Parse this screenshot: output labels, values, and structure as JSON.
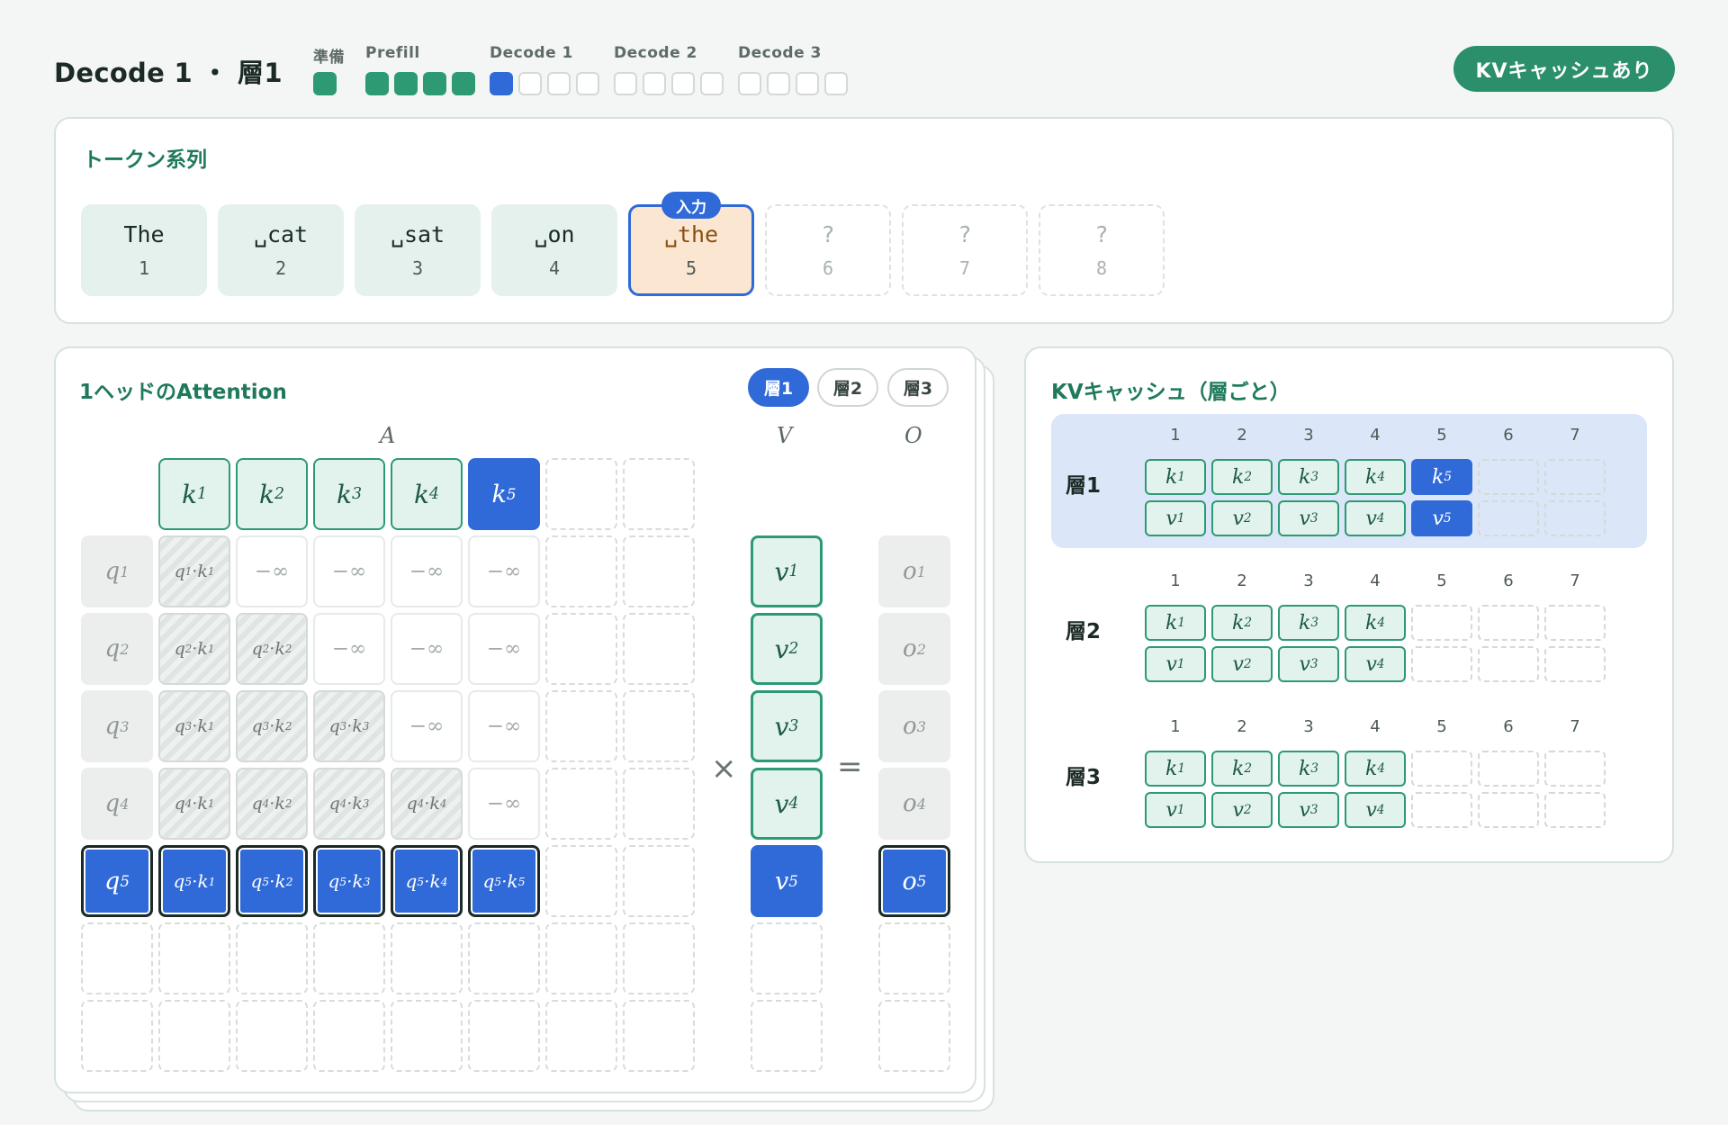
{
  "header": {
    "title": "Decode 1 ・ 層1",
    "steps": [
      {
        "label": "準備",
        "blocks": [
          "done"
        ]
      },
      {
        "label": "Prefill",
        "blocks": [
          "done",
          "done",
          "done",
          "done"
        ]
      },
      {
        "label": "Decode 1",
        "blocks": [
          "current",
          "todo",
          "todo",
          "todo"
        ]
      },
      {
        "label": "Decode 2",
        "blocks": [
          "todo",
          "todo",
          "todo",
          "todo"
        ]
      },
      {
        "label": "Decode 3",
        "blocks": [
          "todo",
          "todo",
          "todo",
          "todo"
        ]
      }
    ],
    "kv_badge": "KVキャッシュあり"
  },
  "tokens": {
    "title": "トークン系列",
    "input_badge": "入力",
    "items": [
      {
        "text": "␣The",
        "display": "The",
        "index": "1",
        "state": "filled"
      },
      {
        "text": "␣cat",
        "display": "␣cat",
        "index": "2",
        "state": "filled"
      },
      {
        "text": "␣sat",
        "display": "␣sat",
        "index": "3",
        "state": "filled"
      },
      {
        "text": "␣on",
        "display": "␣on",
        "index": "4",
        "state": "filled"
      },
      {
        "text": "␣the",
        "display": "␣the",
        "index": "5",
        "state": "input"
      },
      {
        "text": "?",
        "display": "?",
        "index": "6",
        "state": "empty"
      },
      {
        "text": "?",
        "display": "?",
        "index": "7",
        "state": "empty"
      },
      {
        "text": "?",
        "display": "?",
        "index": "8",
        "state": "empty"
      }
    ]
  },
  "attention": {
    "title": "1ヘッドのAttention",
    "layer_pills": [
      "層1",
      "層2",
      "層3"
    ],
    "active_layer": "層1",
    "labels": {
      "A": "A",
      "V": "V",
      "O": "O"
    },
    "ops": {
      "times": "×",
      "equals": "="
    },
    "neg_inf": "−∞"
  },
  "kv_cache": {
    "title": "KVキャッシュ（層ごと）",
    "columns": [
      "1",
      "2",
      "3",
      "4",
      "5",
      "6",
      "7"
    ],
    "layers": [
      {
        "label": "層1",
        "filled": 4,
        "new": 1,
        "highlight": true
      },
      {
        "label": "層2",
        "filled": 4,
        "new": 0,
        "highlight": false
      },
      {
        "label": "層3",
        "filled": 4,
        "new": 0,
        "highlight": false
      }
    ]
  },
  "colors": {
    "accent_green": "#2e9a73",
    "accent_blue": "#2f6ad8",
    "input_bg": "#fbe7d1"
  }
}
